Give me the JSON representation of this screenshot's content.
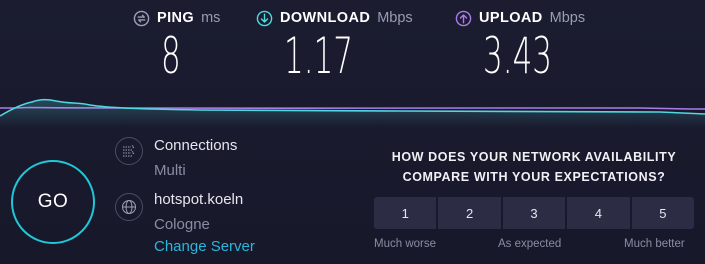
{
  "metrics": {
    "ping": {
      "label": "PING",
      "unit": "ms",
      "value": "8",
      "icon": "ping-icon",
      "color": "#9ea0b6"
    },
    "download": {
      "label": "DOWNLOAD",
      "unit": "Mbps",
      "value": "1.17",
      "icon": "download-arrow-icon",
      "color": "#4fd8e0"
    },
    "upload": {
      "label": "UPLOAD",
      "unit": "Mbps",
      "value": "3.43",
      "icon": "upload-arrow-icon",
      "color": "#a97ce8"
    }
  },
  "go_button": {
    "label": "GO",
    "color": "#1fc7d8"
  },
  "connection": {
    "title": "Connections",
    "mode": "Multi",
    "icon": "connections-icon"
  },
  "server": {
    "host": "hotspot.koeln",
    "location": "Cologne",
    "change_link": "Change Server",
    "icon": "globe-icon"
  },
  "survey": {
    "question_line1": "HOW DOES YOUR NETWORK AVAILABILITY",
    "question_line2": "COMPARE WITH YOUR EXPECTATIONS?",
    "ratings": [
      "1",
      "2",
      "3",
      "4",
      "5"
    ],
    "scale_low": "Much worse",
    "scale_mid": "As expected",
    "scale_high": "Much better"
  },
  "colors": {
    "background": "#1b1c30",
    "download_line": "#4fd8e0",
    "upload_line": "#a97ce8",
    "link": "#29b6dd"
  }
}
